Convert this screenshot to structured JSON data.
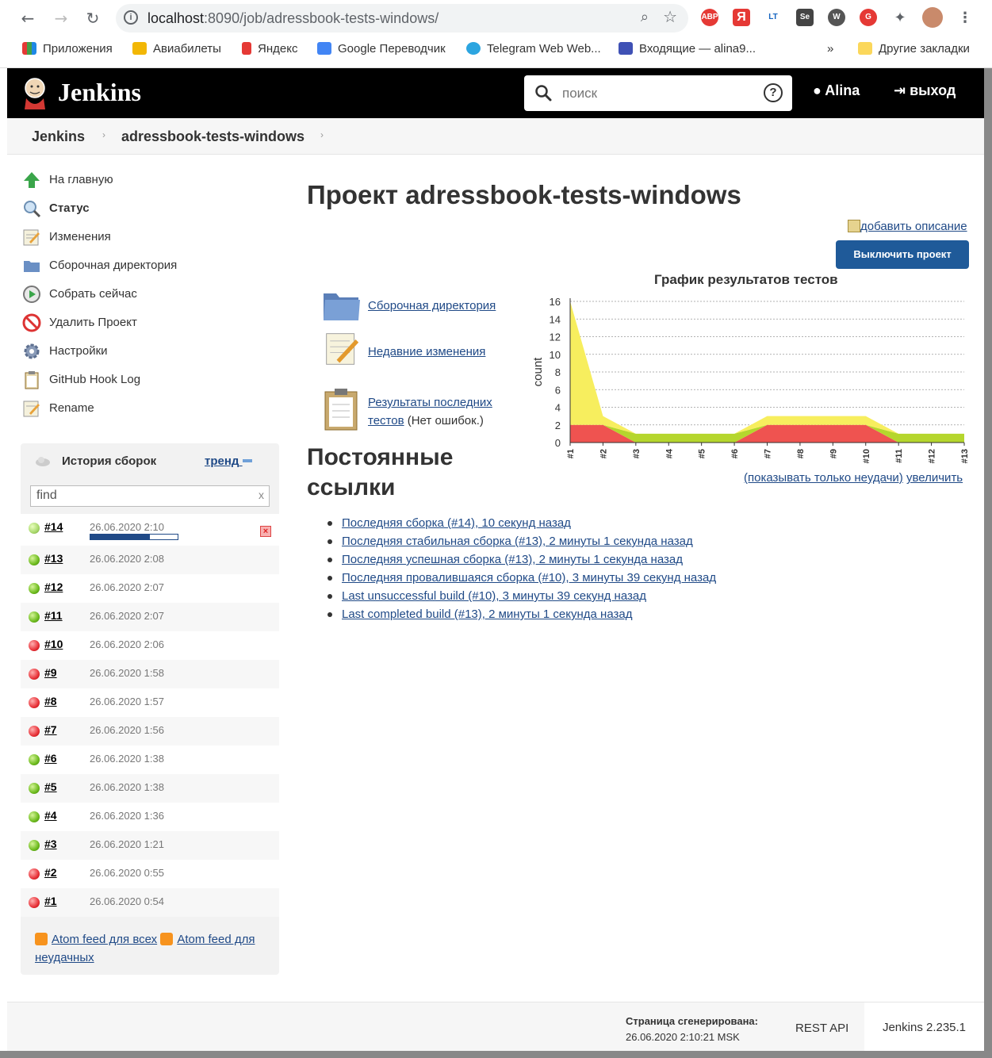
{
  "browser": {
    "url_host": "localhost",
    "url_path": ":8090/job/adressbook-tests-windows/",
    "extensions": [
      "ABP",
      "Я",
      "LT",
      "Se",
      "W",
      "G"
    ],
    "bookmarks": [
      "Приложения",
      "Авиабилеты",
      "Яндекс",
      "Google Переводчик",
      "Telegram Web Web...",
      "Входящие — alina9...",
      "»",
      "Другие закладки"
    ]
  },
  "header": {
    "logo": "Jenkins",
    "search_placeholder": "поиск",
    "user": "Alina",
    "logout": "выход"
  },
  "breadcrumb": [
    "Jenkins",
    "adressbook-tests-windows"
  ],
  "tasks": [
    "На главную",
    "Статус",
    "Изменения",
    "Сборочная директория",
    "Собрать сейчас",
    "Удалить Проект",
    "Настройки",
    "GitHub Hook Log",
    "Rename"
  ],
  "build_history": {
    "title": "История сборок",
    "trend": "тренд",
    "find_value": "find",
    "builds": [
      {
        "num": "#14",
        "date": "26.06.2020 2:10",
        "status": "running",
        "progress": 0.68
      },
      {
        "num": "#13",
        "date": "26.06.2020 2:08",
        "status": "success"
      },
      {
        "num": "#12",
        "date": "26.06.2020 2:07",
        "status": "success"
      },
      {
        "num": "#11",
        "date": "26.06.2020 2:07",
        "status": "success"
      },
      {
        "num": "#10",
        "date": "26.06.2020 2:06",
        "status": "failed"
      },
      {
        "num": "#9",
        "date": "26.06.2020 1:58",
        "status": "failed"
      },
      {
        "num": "#8",
        "date": "26.06.2020 1:57",
        "status": "failed"
      },
      {
        "num": "#7",
        "date": "26.06.2020 1:56",
        "status": "failed"
      },
      {
        "num": "#6",
        "date": "26.06.2020 1:38",
        "status": "success"
      },
      {
        "num": "#5",
        "date": "26.06.2020 1:38",
        "status": "success"
      },
      {
        "num": "#4",
        "date": "26.06.2020 1:36",
        "status": "success"
      },
      {
        "num": "#3",
        "date": "26.06.2020 1:21",
        "status": "success"
      },
      {
        "num": "#2",
        "date": "26.06.2020 0:55",
        "status": "failed"
      },
      {
        "num": "#1",
        "date": "26.06.2020 0:54",
        "status": "failed"
      }
    ],
    "feed_all": "Atom feed для всех",
    "feed_failed": "Atom feed для неудачных"
  },
  "main": {
    "title": "Проект adressbook-tests-windows",
    "add_description": "добавить описание",
    "disable_button": "Выключить проект",
    "links": {
      "workspace": "Сборочная директория",
      "changes": "Недавние изменения",
      "test_results_line1": "Результаты последних",
      "test_results_line2": "тестов",
      "test_results_note": "(Нет ошибок.)"
    },
    "permalinks_title": "Постоянные ссылки",
    "permalinks": [
      "Последняя сборка (#14), 10 секунд назад",
      "Последняя стабильная сборка (#13), 2 минуты 1 секунда назад",
      "Последняя успешная сборка (#13), 2 минуты 1 секунда назад",
      "Последняя провалившаяся сборка (#10), 3 минуты 39 секунд назад",
      "Last unsuccessful build (#10), 3 минуты 39 секунд назад",
      "Last completed build (#13), 2 минуты 1 секунда назад"
    ],
    "chart_only_failed": "(показывать только неудачи)",
    "chart_enlarge": "увеличить"
  },
  "chart_data": {
    "type": "area",
    "title": "График результатов тестов",
    "ylabel": "count",
    "ylim": [
      0,
      16
    ],
    "yticks": [
      0,
      2,
      4,
      6,
      8,
      10,
      12,
      14,
      16
    ],
    "categories": [
      "#1",
      "#2",
      "#3",
      "#4",
      "#5",
      "#6",
      "#7",
      "#8",
      "#9",
      "#10",
      "#11",
      "#12",
      "#13"
    ],
    "series": [
      {
        "values": [
          2,
          2,
          0,
          0,
          0,
          0,
          2,
          2,
          2,
          2,
          0,
          0,
          0
        ],
        "color": "#ef5350"
      },
      {
        "values": [
          0,
          0,
          1,
          1,
          1,
          1,
          0,
          0,
          0,
          0,
          1,
          1,
          1
        ],
        "color": "#b5d62d"
      },
      {
        "values": [
          14,
          1,
          0,
          0,
          0,
          0,
          1,
          1,
          1,
          1,
          0,
          0,
          0
        ],
        "color": "#f7ee5e"
      }
    ],
    "grid": true
  },
  "footer": {
    "generated_label": "Страница сгенерирована:",
    "generated_time": "26.06.2020 2:10:21 MSK",
    "rest_api": "REST API",
    "version": "Jenkins 2.235.1"
  }
}
